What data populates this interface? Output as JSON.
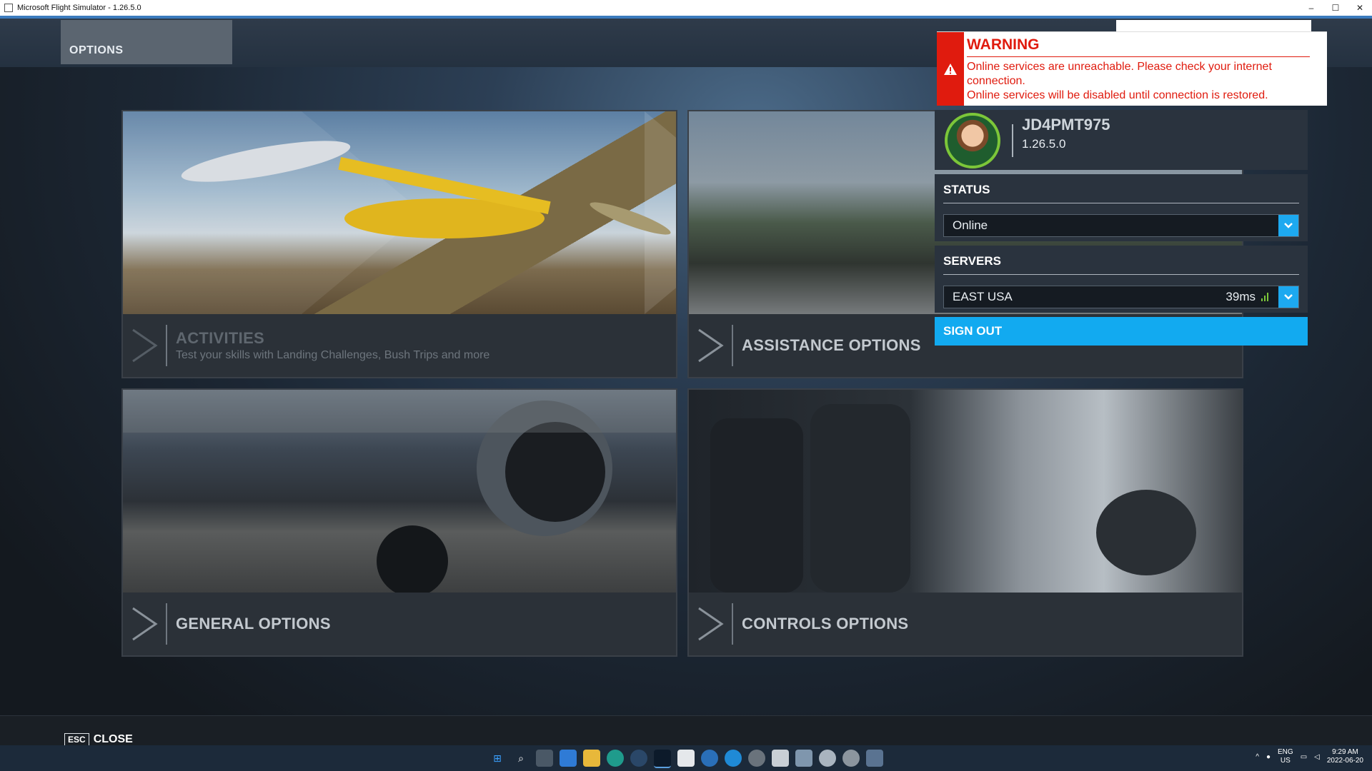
{
  "window": {
    "title": "Microsoft Flight Simulator - 1.26.5.0",
    "controls": [
      "–",
      "☐",
      "✕"
    ]
  },
  "header": {
    "tab_label": "OPTIONS"
  },
  "tiles": [
    {
      "id": "activities",
      "title": "ACTIVITIES",
      "subtitle": "Test your skills with Landing Challenges, Bush Trips and more"
    },
    {
      "id": "assistance",
      "title": "ASSISTANCE OPTIONS",
      "subtitle": ""
    },
    {
      "id": "general",
      "title": "GENERAL OPTIONS",
      "subtitle": ""
    },
    {
      "id": "controls",
      "title": "CONTROLS OPTIONS",
      "subtitle": ""
    }
  ],
  "profile": {
    "username": "JD4PMT975",
    "version": "1.26.5.0",
    "status_header": "STATUS",
    "status_value": "Online",
    "servers_header": "SERVERS",
    "server_value": "EAST USA",
    "server_ping": "39ms",
    "sign_out_label": "SIGN OUT"
  },
  "warning": {
    "title": "WARNING",
    "message_1": "Online services are unreachable. Please check your internet connection.",
    "message_2": "Online services will be disabled until connection is restored."
  },
  "footer": {
    "esc_key": "ESC",
    "close_label": "CLOSE"
  },
  "taskbar": {
    "icons": [
      "windows-start-icon",
      "search-icon",
      "task-view-icon",
      "store-icon",
      "file-explorer-icon",
      "edge-icon",
      "steam-icon",
      "flight-sim-icon",
      "app-icon",
      "app-icon",
      "app-icon",
      "app-icon",
      "app-icon",
      "app-icon",
      "app-icon",
      "app-icon",
      "app-icon",
      "app-icon"
    ],
    "lang_line1": "ENG",
    "lang_line2": "US",
    "time": "9:29 AM",
    "date": "2022-06-20"
  },
  "colors": {
    "accent": "#12aaf0",
    "warning": "#e01b0e",
    "online_ring": "#7cc639"
  }
}
